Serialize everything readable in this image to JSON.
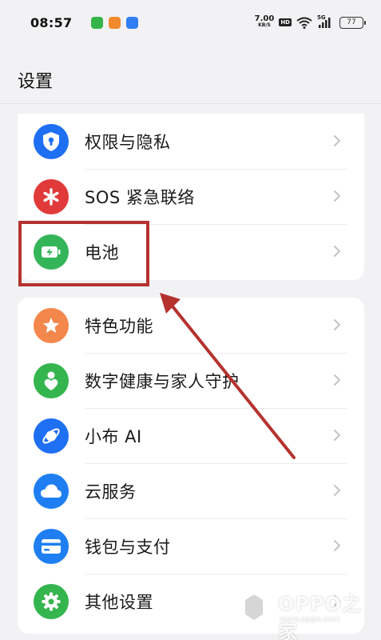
{
  "status_bar": {
    "time": "08:57",
    "net_speed": "7.00",
    "net_speed_unit": "KB/S",
    "hd": "HD",
    "network": "5G",
    "battery": "77"
  },
  "header": {
    "title": "设置"
  },
  "colors": {
    "privacy": "#1f6ff2",
    "sos": "#e03a3a",
    "battery": "#34b55a",
    "features": "#f4874b",
    "wellbeing": "#35b54e",
    "breeno": "#1f6ff2",
    "cloud": "#1f7ff2",
    "wallet": "#1f7ff2",
    "other": "#35b54e",
    "annotation": "#b5322f"
  },
  "group1": [
    {
      "label": "权限与隐私",
      "icon": "shield-lock-icon"
    },
    {
      "label": "SOS 紧急联络",
      "icon": "asterisk-icon"
    },
    {
      "label": "电池",
      "icon": "battery-icon"
    }
  ],
  "group2": [
    {
      "label": "特色功能",
      "icon": "star-icon"
    },
    {
      "label": "数字健康与家人守护",
      "icon": "family-heart-icon"
    },
    {
      "label": "小布 AI",
      "icon": "ai-orbit-icon"
    },
    {
      "label": "云服务",
      "icon": "cloud-icon"
    },
    {
      "label": "钱包与支付",
      "icon": "wallet-card-icon"
    },
    {
      "label": "其他设置",
      "icon": "gear-icon"
    }
  ],
  "watermark": {
    "text": "OPPO之家",
    "url": "www.oppo.com"
  }
}
